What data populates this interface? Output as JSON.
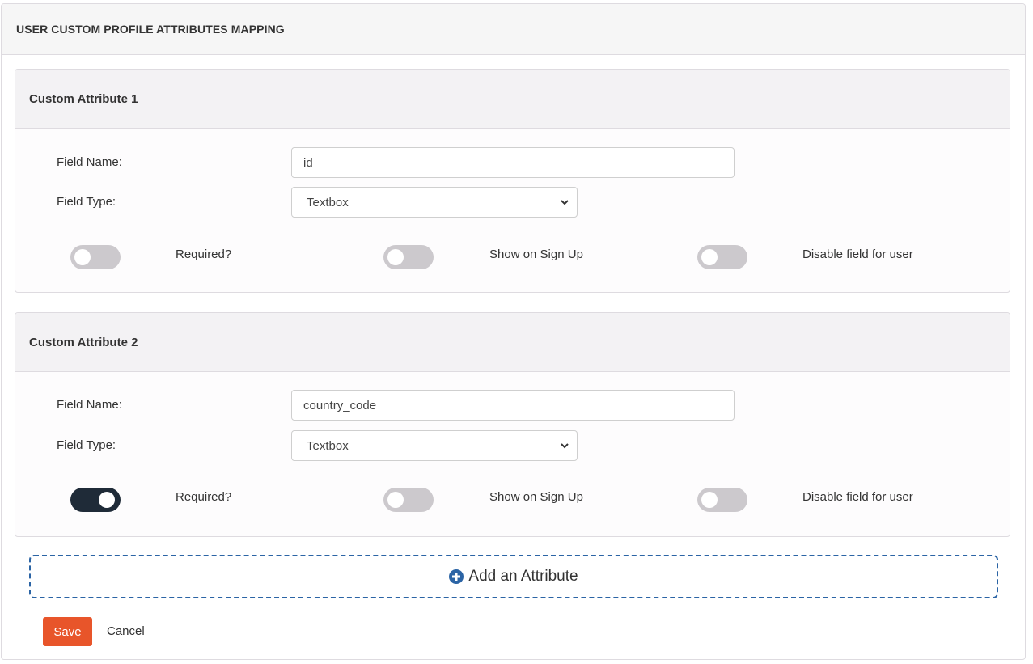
{
  "panel": {
    "title": "USER CUSTOM PROFILE ATTRIBUTES MAPPING"
  },
  "attributes": [
    {
      "title": "Custom Attribute 1",
      "field_name_label": "Field Name:",
      "field_name_value": "id",
      "field_type_label": "Field Type:",
      "field_type_value": "Textbox",
      "toggles": [
        {
          "label": "Required?",
          "on": false
        },
        {
          "label": "Show on Sign Up",
          "on": false
        },
        {
          "label": "Disable field for user",
          "on": false
        }
      ]
    },
    {
      "title": "Custom Attribute 2",
      "field_name_label": "Field Name:",
      "field_name_value": "country_code",
      "field_type_label": "Field Type:",
      "field_type_value": "Textbox",
      "toggles": [
        {
          "label": "Required?",
          "on": true
        },
        {
          "label": "Show on Sign Up",
          "on": false
        },
        {
          "label": "Disable field for user",
          "on": false
        }
      ]
    }
  ],
  "add_attribute": {
    "label": "Add an Attribute",
    "icon": "plus-circle-icon"
  },
  "actions": {
    "save_label": "Save",
    "cancel_label": "Cancel"
  },
  "colors": {
    "save": "#e8552a",
    "toggle_on": "#1f2b38",
    "toggle_off": "#ccc9cd",
    "add_border": "#2b64a5"
  }
}
